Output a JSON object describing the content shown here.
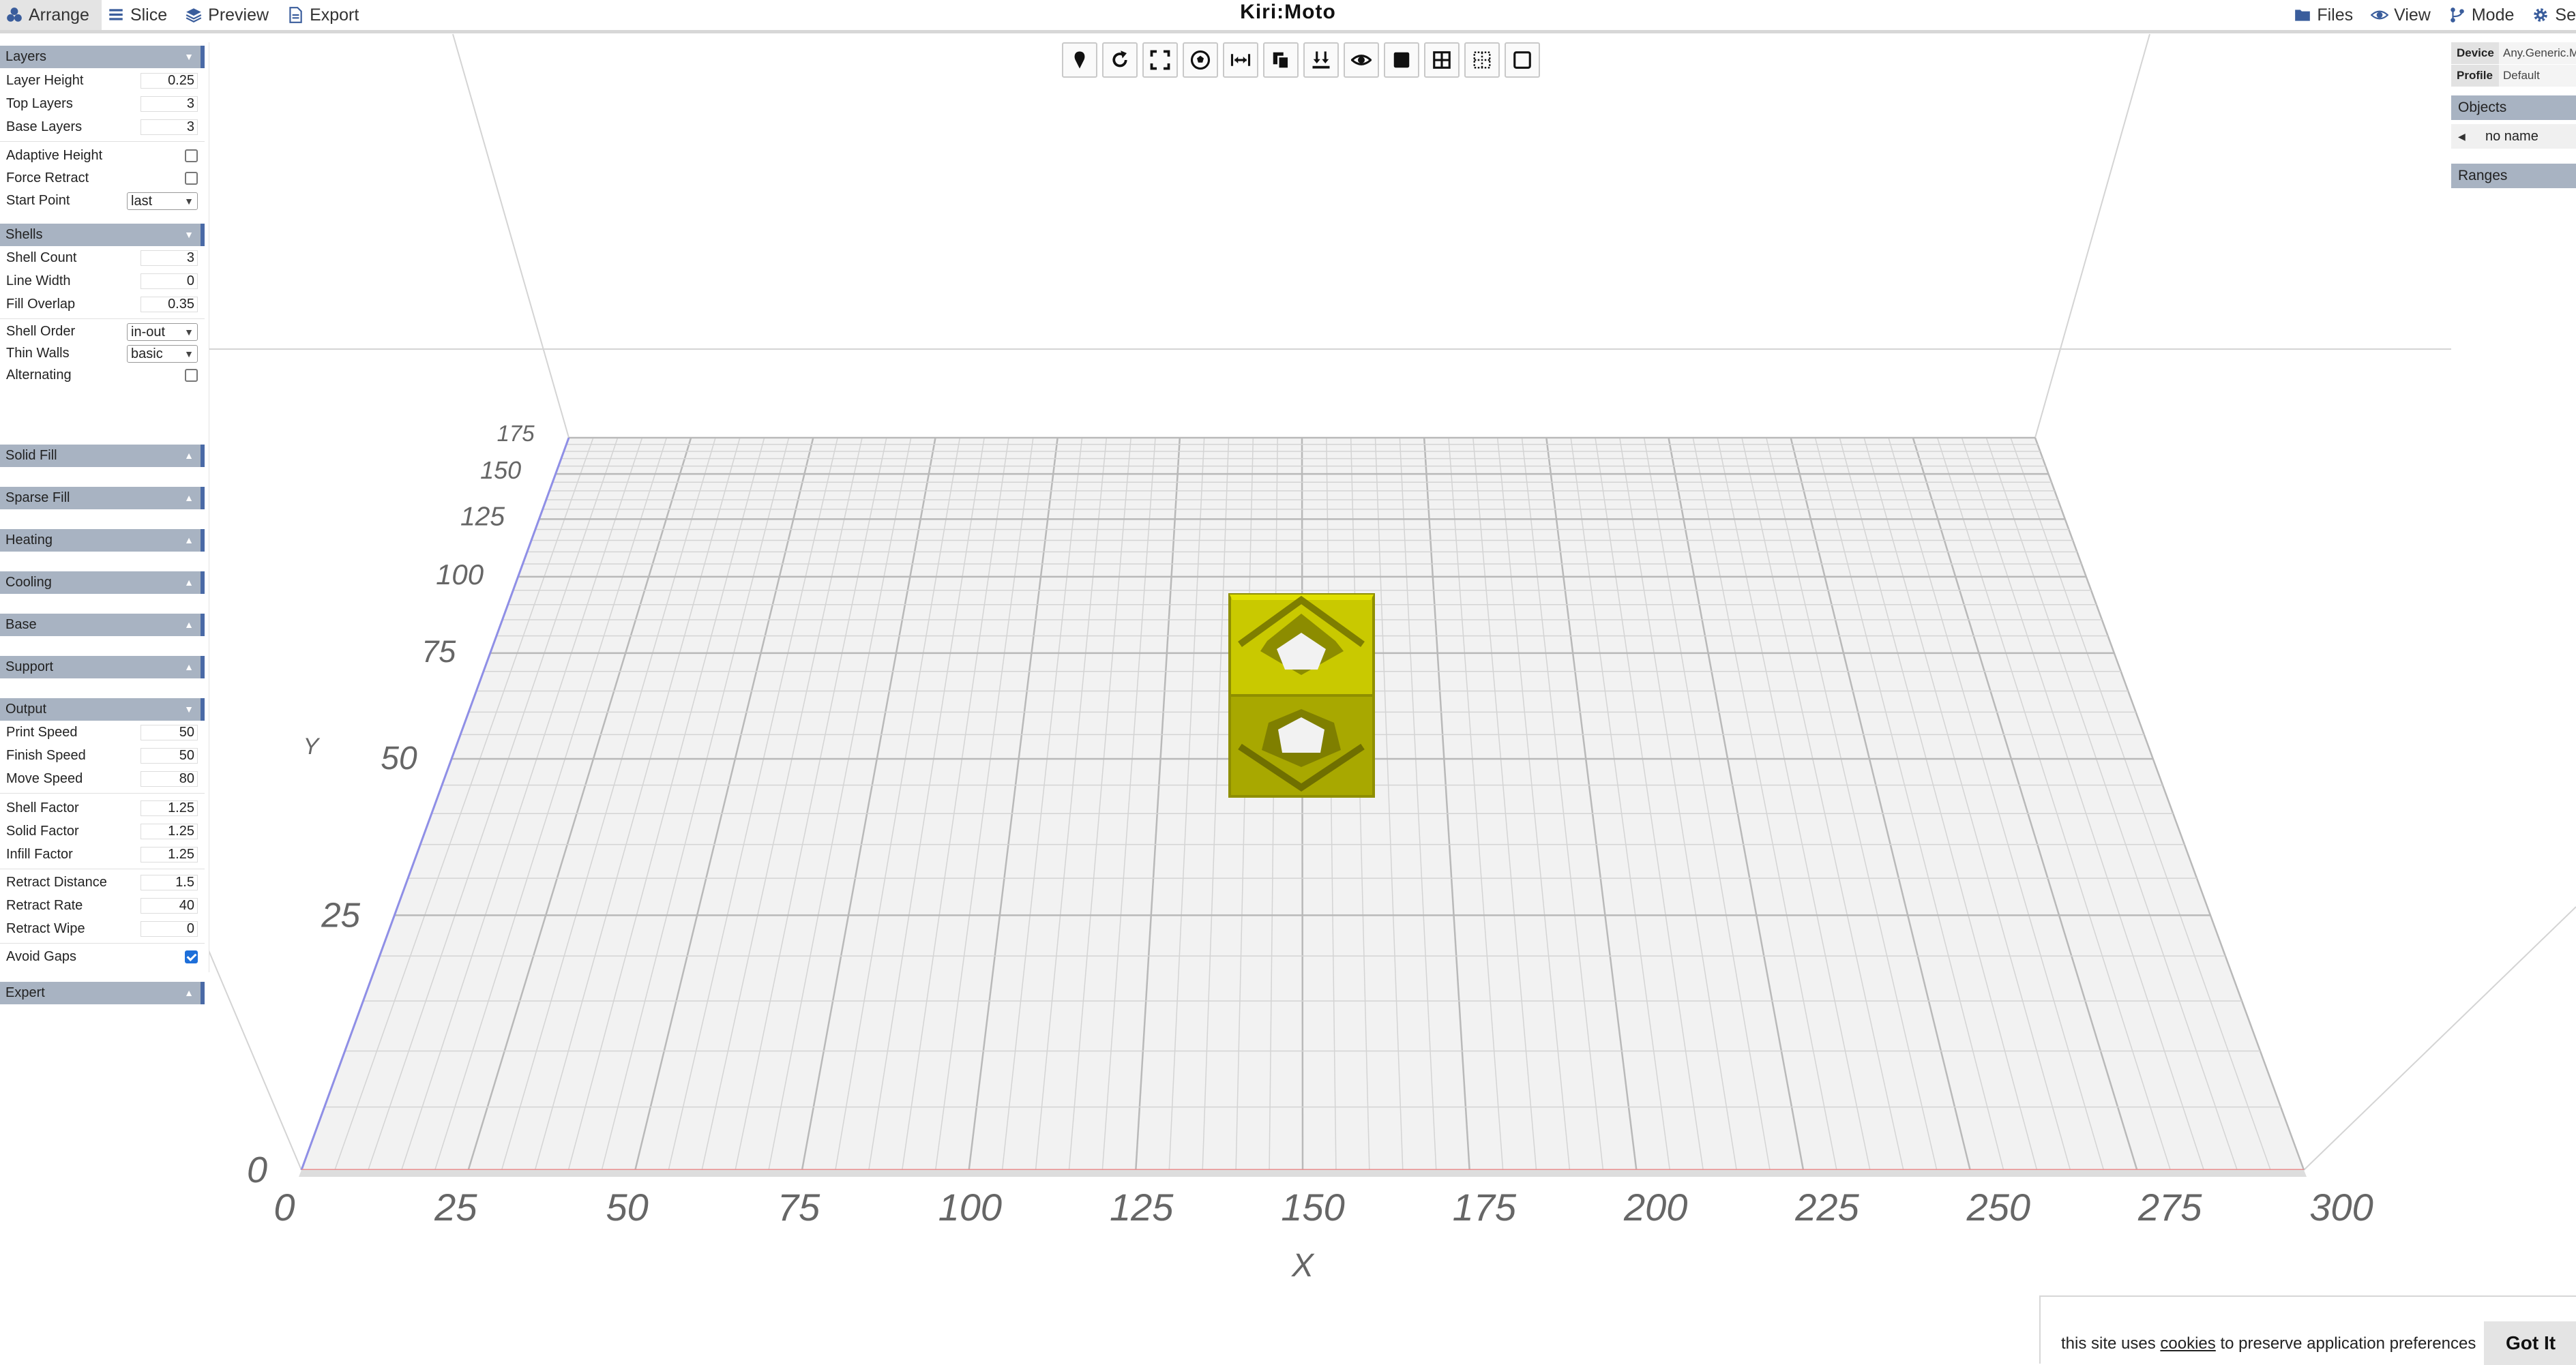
{
  "topbar": {
    "title": "Kiri:Moto",
    "left_menu": [
      {
        "label": "Arrange",
        "icon": "arrange-icon"
      },
      {
        "label": "Slice",
        "icon": "slice-icon"
      },
      {
        "label": "Preview",
        "icon": "preview-icon"
      },
      {
        "label": "Export",
        "icon": "export-icon"
      }
    ],
    "right_menu": [
      {
        "label": "Files",
        "icon": "folder-icon"
      },
      {
        "label": "View",
        "icon": "eye-icon"
      },
      {
        "label": "Mode",
        "icon": "branch-icon"
      },
      {
        "label": "Se",
        "icon": "gear-icon"
      }
    ]
  },
  "left_panel": {
    "layers": {
      "title": "Layers",
      "layer_height_label": "Layer Height",
      "layer_height": "0.25",
      "top_layers_label": "Top Layers",
      "top_layers": "3",
      "base_layers_label": "Base Layers",
      "base_layers": "3",
      "adaptive_height_label": "Adaptive Height",
      "force_retract_label": "Force Retract",
      "start_point_label": "Start Point",
      "start_point": "last"
    },
    "shells": {
      "title": "Shells",
      "shell_count_label": "Shell Count",
      "shell_count": "3",
      "line_width_label": "Line Width",
      "line_width": "0",
      "fill_overlap_label": "Fill Overlap",
      "fill_overlap": "0.35",
      "shell_order_label": "Shell Order",
      "shell_order": "in-out",
      "thin_walls_label": "Thin Walls",
      "thin_walls": "basic",
      "alternating_label": "Alternating"
    },
    "collapsed": {
      "solid_fill": "Solid Fill",
      "sparse_fill": "Sparse Fill",
      "heating": "Heating",
      "cooling": "Cooling",
      "base": "Base",
      "support": "Support"
    },
    "output": {
      "title": "Output",
      "print_speed_label": "Print Speed",
      "print_speed": "50",
      "finish_speed_label": "Finish Speed",
      "finish_speed": "50",
      "move_speed_label": "Move Speed",
      "move_speed": "80",
      "shell_factor_label": "Shell Factor",
      "shell_factor": "1.25",
      "solid_factor_label": "Solid Factor",
      "solid_factor": "1.25",
      "infill_factor_label": "Infill Factor",
      "infill_factor": "1.25",
      "retract_distance_label": "Retract Distance",
      "retract_distance": "1.5",
      "retract_rate_label": "Retract Rate",
      "retract_rate": "40",
      "retract_wipe_label": "Retract Wipe",
      "retract_wipe": "0",
      "avoid_gaps_label": "Avoid Gaps"
    },
    "expert": "Expert"
  },
  "right_panel": {
    "device_label": "Device",
    "device": "Any.Generic.M",
    "profile_label": "Profile",
    "profile": "Default",
    "objects_title": "Objects",
    "object_name": "no name",
    "ranges_title": "Ranges"
  },
  "toolbar_icons": [
    "pin-icon",
    "rotate-icon",
    "fit-icon",
    "soccer-ball-icon",
    "arrows-horizontal-icon",
    "copy-icon",
    "drop-down-icon",
    "eye-icon",
    "solid-square-icon",
    "grid-icon",
    "dotted-grid-icon",
    "square-outline-icon"
  ],
  "plate": {
    "x_axis_label": "X",
    "y_axis_label": "Y",
    "x_ticks": [
      "0",
      "25",
      "50",
      "75",
      "100",
      "125",
      "150",
      "175",
      "200",
      "225",
      "250",
      "275",
      "300"
    ],
    "y_ticks": [
      "0",
      "25",
      "50",
      "75",
      "100",
      "125",
      "150",
      "175"
    ]
  },
  "cookie": {
    "text_before": "this site uses ",
    "link": "cookies",
    "text_after": " to preserve application preferences",
    "button": "Got It"
  },
  "colors": {
    "section_header": "#a8b3c2",
    "section_accent": "#4a6aa6",
    "model": "#cccc00",
    "grid": "#c8c8c8",
    "plate": "#f2f2f2"
  }
}
